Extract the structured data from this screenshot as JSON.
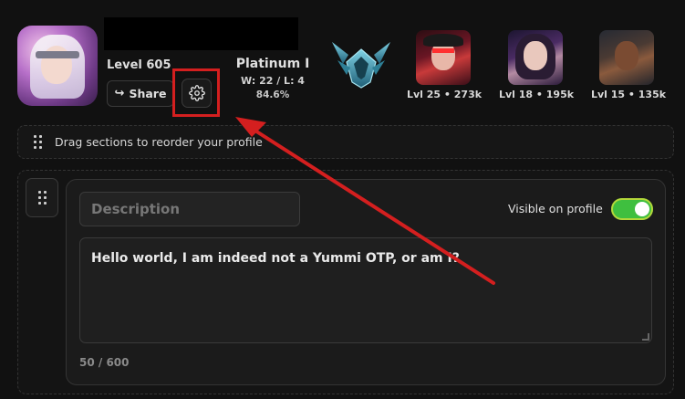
{
  "profile": {
    "level_label": "Level 605",
    "share_label": "Share",
    "share_icon": "share-arrow-icon",
    "settings_icon": "gear-icon"
  },
  "rank": {
    "tier": "Platinum I",
    "win_loss": "W: 22 / L: 4",
    "winrate": "84.6%",
    "emblem_icon": "platinum-emblem-icon"
  },
  "champions": [
    {
      "label": "Lvl 25 • 273k"
    },
    {
      "label": "Lvl 18 • 195k"
    },
    {
      "label": "Lvl 15 • 135k"
    }
  ],
  "drag_hint": "Drag sections to reorder your profile",
  "section": {
    "title_placeholder": "Description",
    "visible_label": "Visible on profile",
    "visible_on": true,
    "description_text": "Hello world, I am indeed not a Yummi OTP, or am I?",
    "char_counter": "50 / 600"
  },
  "colors": {
    "background": "#111111",
    "toggle_on": "#3fbf3f",
    "annotation_red": "#d41f1f"
  }
}
